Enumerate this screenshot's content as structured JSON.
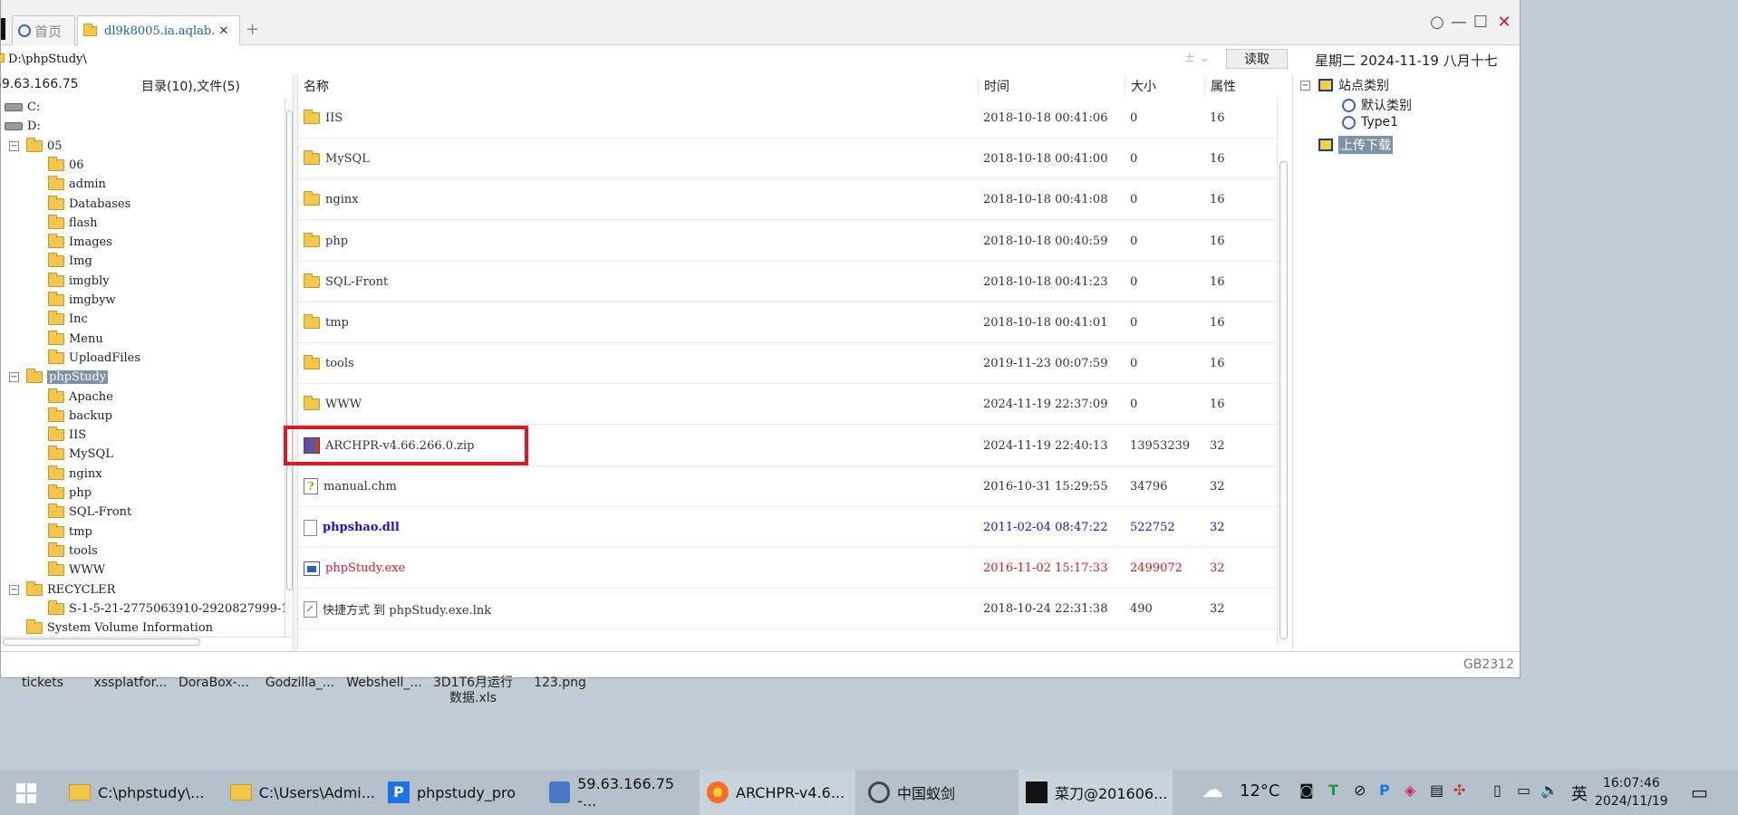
{
  "tabs": [
    {
      "label": "首页"
    },
    {
      "label": "dl9k8005.ia.aqlab."
    }
  ],
  "tab_add": "+",
  "window_controls": {
    "circle": "○",
    "minimize": "—",
    "maximize": "☐",
    "close": "✕"
  },
  "address": {
    "value": "D:\\phpStudy\\",
    "icons": "± ⌄"
  },
  "read_button": "读取",
  "date_bar": "星期二  2024-11-19  八月十七",
  "tree_header": {
    "ip": "59.63.166.75",
    "summary": "目录(10),文件(5)"
  },
  "tree": [
    {
      "label": "C:",
      "level": 0,
      "kind": "drive"
    },
    {
      "label": "D:",
      "level": 0,
      "kind": "drive"
    },
    {
      "label": "05",
      "level": 0,
      "kind": "folder",
      "expander": "−"
    },
    {
      "label": "06",
      "level": 1,
      "kind": "folder"
    },
    {
      "label": "admin",
      "level": 1,
      "kind": "folder"
    },
    {
      "label": "Databases",
      "level": 1,
      "kind": "folder"
    },
    {
      "label": "flash",
      "level": 1,
      "kind": "folder"
    },
    {
      "label": "Images",
      "level": 1,
      "kind": "folder"
    },
    {
      "label": "Img",
      "level": 1,
      "kind": "folder"
    },
    {
      "label": "imgbly",
      "level": 1,
      "kind": "folder"
    },
    {
      "label": "imgbyw",
      "level": 1,
      "kind": "folder"
    },
    {
      "label": "Inc",
      "level": 1,
      "kind": "folder"
    },
    {
      "label": "Menu",
      "level": 1,
      "kind": "folder"
    },
    {
      "label": "UploadFiles",
      "level": 1,
      "kind": "folder"
    },
    {
      "label": "phpStudy",
      "level": 0,
      "kind": "folder",
      "expander": "−",
      "selected": true
    },
    {
      "label": "Apache",
      "level": 1,
      "kind": "folder"
    },
    {
      "label": "backup",
      "level": 1,
      "kind": "folder"
    },
    {
      "label": "IIS",
      "level": 1,
      "kind": "folder"
    },
    {
      "label": "MySQL",
      "level": 1,
      "kind": "folder"
    },
    {
      "label": "nginx",
      "level": 1,
      "kind": "folder"
    },
    {
      "label": "php",
      "level": 1,
      "kind": "folder"
    },
    {
      "label": "SQL-Front",
      "level": 1,
      "kind": "folder"
    },
    {
      "label": "tmp",
      "level": 1,
      "kind": "folder"
    },
    {
      "label": "tools",
      "level": 1,
      "kind": "folder"
    },
    {
      "label": "WWW",
      "level": 1,
      "kind": "folder"
    },
    {
      "label": "RECYCLER",
      "level": 0,
      "kind": "folder",
      "expander": "−"
    },
    {
      "label": "S-1-5-21-2775063910-2920827999-1",
      "level": 1,
      "kind": "folder"
    },
    {
      "label": "System Volume Information",
      "level": 0,
      "kind": "folder"
    }
  ],
  "list_columns": {
    "name": "名称",
    "time": "时间",
    "size": "大小",
    "attr": "属性"
  },
  "files": [
    {
      "name": "IIS",
      "time": "2018-10-18 00:41:06",
      "size": "0",
      "attr": "16",
      "kind": "folder",
      "style": ""
    },
    {
      "name": "MySQL",
      "time": "2018-10-18 00:41:00",
      "size": "0",
      "attr": "16",
      "kind": "folder",
      "style": ""
    },
    {
      "name": "nginx",
      "time": "2018-10-18 00:41:08",
      "size": "0",
      "attr": "16",
      "kind": "folder",
      "style": ""
    },
    {
      "name": "php",
      "time": "2018-10-18 00:40:59",
      "size": "0",
      "attr": "16",
      "kind": "folder",
      "style": ""
    },
    {
      "name": "SQL-Front",
      "time": "2018-10-18 00:41:23",
      "size": "0",
      "attr": "16",
      "kind": "folder",
      "style": ""
    },
    {
      "name": "tmp",
      "time": "2018-10-18 00:41:01",
      "size": "0",
      "attr": "16",
      "kind": "folder",
      "style": ""
    },
    {
      "name": "tools",
      "time": "2019-11-23 00:07:59",
      "size": "0",
      "attr": "16",
      "kind": "folder",
      "style": ""
    },
    {
      "name": "WWW",
      "time": "2024-11-19 22:37:09",
      "size": "0",
      "attr": "16",
      "kind": "folder",
      "style": ""
    },
    {
      "name": "ARCHPR-v4.66.266.0.zip",
      "time": "2024-11-19 22:40:13",
      "size": "13953239",
      "attr": "32",
      "kind": "zip",
      "style": "",
      "highlighted": true
    },
    {
      "name": "manual.chm",
      "time": "2016-10-31 15:29:55",
      "size": "34796",
      "attr": "32",
      "kind": "chm",
      "style": ""
    },
    {
      "name": "phpshao.dll",
      "time": "2011-02-04 08:47:22",
      "size": "522752",
      "attr": "32",
      "kind": "file",
      "style": "blue"
    },
    {
      "name": "phpStudy.exe",
      "time": "2016-11-02 15:17:33",
      "size": "2499072",
      "attr": "32",
      "kind": "exe",
      "style": "red"
    },
    {
      "name": "快捷方式 到 phpStudy.exe.lnk",
      "time": "2018-10-24 22:31:38",
      "size": "490",
      "attr": "32",
      "kind": "lnk",
      "style": ""
    }
  ],
  "right_panel": [
    {
      "label": "站点类别",
      "level": 0,
      "icon": "category-icon",
      "expander": "−"
    },
    {
      "label": "默认类别",
      "level": 1,
      "icon": "circle-icon"
    },
    {
      "label": "Type1",
      "level": 1,
      "icon": "circle-icon"
    },
    {
      "label": "上传下载",
      "level": 0,
      "icon": "category-icon",
      "selected": true
    }
  ],
  "status": {
    "encoding": "GB2312"
  },
  "desktop_icons": [
    {
      "label": "tickets"
    },
    {
      "label": "xssplatfor..."
    },
    {
      "label": "DoraBox-..."
    },
    {
      "label": "Godzilla_..."
    },
    {
      "label": "Webshell_..."
    },
    {
      "label": "3D1T6月运行数据.xls"
    },
    {
      "label": "123.png"
    }
  ],
  "taskbar": {
    "items": [
      {
        "label": "C:\\phpstudy\\...",
        "icon": "folder-icon"
      },
      {
        "label": "C:\\Users\\Admi...",
        "icon": "folder-icon"
      },
      {
        "label": "phpstudy_pro",
        "icon": "phpstudy-icon"
      },
      {
        "label": "59.63.166.75 -...",
        "icon": "remote-desktop-icon"
      },
      {
        "label": "ARCHPR-v4.6...",
        "icon": "firefox-icon"
      },
      {
        "label": "中国蚁剑",
        "icon": "antsword-icon"
      },
      {
        "label": "菜刀@201606...",
        "icon": "caidao-icon"
      }
    ],
    "weather": "12°C",
    "ime": "英",
    "clock": {
      "time": "16:07:46",
      "date": "2024/11/19"
    }
  },
  "colors": {
    "highlight_box": "#e0181e",
    "selected_bg": "#7d93a6",
    "blue_file": "#1515d8",
    "red_file": "#e01818"
  }
}
